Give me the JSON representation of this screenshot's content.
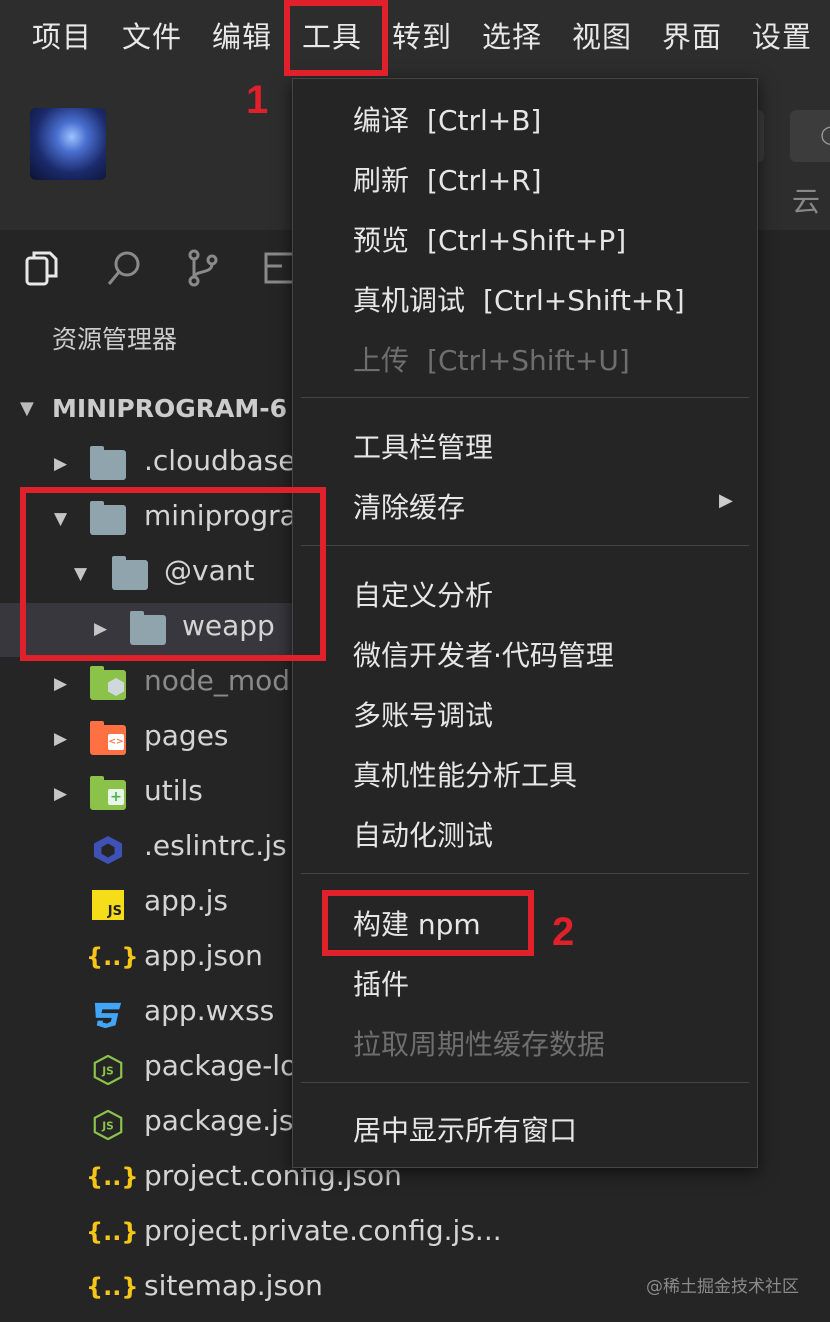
{
  "menubar": {
    "items": [
      "项目",
      "文件",
      "编辑",
      "工具",
      "转到",
      "选择",
      "视图",
      "界面",
      "设置"
    ]
  },
  "toolbar": {
    "label_1": "：",
    "label_2": "云"
  },
  "explorer": {
    "title": "资源管理器",
    "project_name": "MINIPROGRAM-6",
    "rows": [
      {
        "label": ".cloudbase"
      },
      {
        "label": "miniprogra"
      },
      {
        "label": "@vant"
      },
      {
        "label": "weapp"
      },
      {
        "label": "node_mod"
      },
      {
        "label": "pages"
      },
      {
        "label": "utils"
      },
      {
        "label": ".eslintrc.js"
      },
      {
        "label": "app.js"
      },
      {
        "label": "app.json"
      },
      {
        "label": "app.wxss"
      },
      {
        "label": "package-lo"
      },
      {
        "label": "package.js"
      },
      {
        "label": "project.config.json"
      },
      {
        "label": "project.private.config.js..."
      },
      {
        "label": "sitemap.json"
      }
    ],
    "badges": {
      "js": "JS",
      "json": "{..}"
    }
  },
  "dropdown": {
    "groups": [
      [
        {
          "label": "编译",
          "shortcut": "[Ctrl+B]"
        },
        {
          "label": "刷新",
          "shortcut": "[Ctrl+R]"
        },
        {
          "label": "预览",
          "shortcut": "[Ctrl+Shift+P]"
        },
        {
          "label": "真机调试",
          "shortcut": "[Ctrl+Shift+R]"
        },
        {
          "label": "上传",
          "shortcut": "[Ctrl+Shift+U]"
        }
      ],
      [
        {
          "label": "工具栏管理"
        },
        {
          "label": "清除缓存"
        }
      ],
      [
        {
          "label": "自定义分析"
        },
        {
          "label": "微信开发者·代码管理"
        },
        {
          "label": "多账号调试"
        },
        {
          "label": "真机性能分析工具"
        },
        {
          "label": "自动化测试"
        }
      ],
      [
        {
          "label": "构建 npm"
        },
        {
          "label": "插件"
        },
        {
          "label": "拉取周期性缓存数据"
        }
      ],
      [
        {
          "label": "居中显示所有窗口"
        }
      ]
    ]
  },
  "annotations": {
    "step_1": "1",
    "step_2": "2",
    "color": "#e0202a"
  },
  "watermark": "@稀土掘金技术社区",
  "colors": {
    "background": "#252526",
    "menu_bg": "#2d2d2d",
    "selected_row": "#37373d",
    "folder": "#90a4ae",
    "node_modules": "#8bc34a",
    "pages": "#ff7043",
    "utils": "#8bc34a",
    "eslint": "#3f51b5",
    "js_badge": "#f5de19",
    "json": "#f5c518",
    "css": "#42a5f5",
    "node_js": "#8bc34a"
  }
}
